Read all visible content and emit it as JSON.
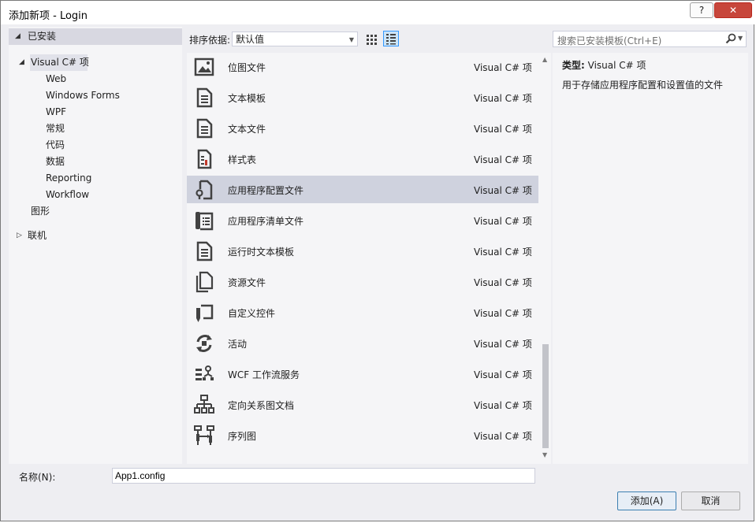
{
  "window": {
    "title": "添加新项 - Login",
    "help_label": "?",
    "close_label": "✕"
  },
  "tree": {
    "installed": "已安装",
    "visual_csharp": "Visual C# 项",
    "children": [
      "Web",
      "Windows Forms",
      "WPF",
      "常规",
      "代码",
      "数据",
      "Reporting",
      "Workflow"
    ],
    "graphics": "图形",
    "online": "联机"
  },
  "toolbar": {
    "sort_label": "排序依据:",
    "sort_value": "默认值"
  },
  "search": {
    "placeholder": "搜索已安装模板(Ctrl+E)"
  },
  "items": [
    {
      "name": "位图文件",
      "type": "Visual C# 项",
      "icon": "bitmap-icon"
    },
    {
      "name": "文本模板",
      "type": "Visual C# 项",
      "icon": "document-icon"
    },
    {
      "name": "文本文件",
      "type": "Visual C# 项",
      "icon": "document-icon"
    },
    {
      "name": "样式表",
      "type": "Visual C# 项",
      "icon": "stylesheet-icon"
    },
    {
      "name": "应用程序配置文件",
      "type": "Visual C# 项",
      "icon": "config-file-icon",
      "selected": true
    },
    {
      "name": "应用程序清单文件",
      "type": "Visual C# 项",
      "icon": "manifest-icon"
    },
    {
      "name": "运行时文本模板",
      "type": "Visual C# 项",
      "icon": "document-icon"
    },
    {
      "name": "资源文件",
      "type": "Visual C# 项",
      "icon": "resource-file-icon"
    },
    {
      "name": "自定义控件",
      "type": "Visual C# 项",
      "icon": "custom-control-icon"
    },
    {
      "name": "活动",
      "type": "Visual C# 项",
      "icon": "activity-icon"
    },
    {
      "name": "WCF 工作流服务",
      "type": "Visual C# 项",
      "icon": "wcf-service-icon"
    },
    {
      "name": "定向关系图文档",
      "type": "Visual C# 项",
      "icon": "directed-graph-icon"
    },
    {
      "name": "序列图",
      "type": "Visual C# 项",
      "icon": "sequence-diagram-icon"
    }
  ],
  "details": {
    "type_label": "类型:",
    "type_value": "Visual C# 项",
    "description": "用于存储应用程序配置和设置值的文件"
  },
  "name_field": {
    "label": "名称(N):",
    "value": "App1.config"
  },
  "buttons": {
    "add": "添加(A)",
    "cancel": "取消"
  }
}
